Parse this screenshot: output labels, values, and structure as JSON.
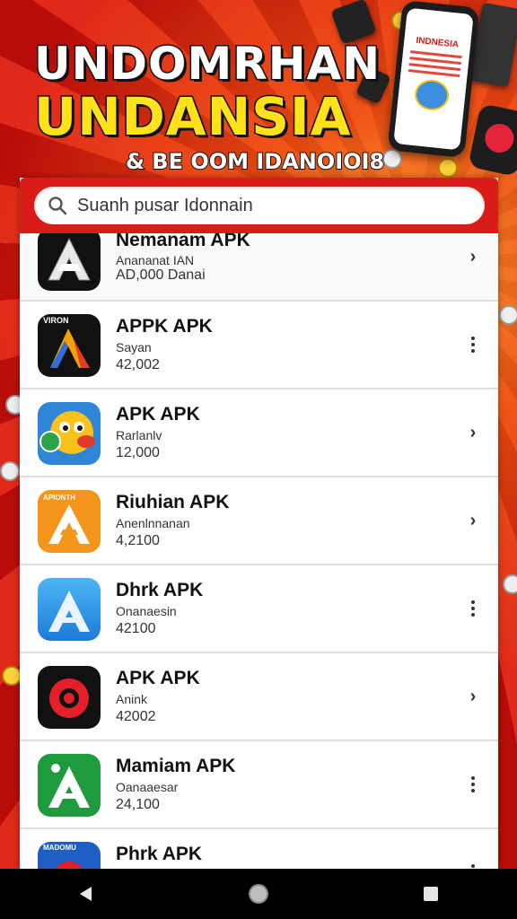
{
  "banner": {
    "title_line1": "UNDOMRHAN",
    "title_line2": "UNDANSIA",
    "subtitle": "& BE OOM IDANOIOI8",
    "phone_screen_title": "INDNESIA"
  },
  "search": {
    "placeholder": "Suanh pusar Idonnain"
  },
  "apps": [
    {
      "name": "Nemanam APK",
      "subtitle": "Anananat IAN",
      "size": "AD,000 Danai",
      "action": "chevron"
    },
    {
      "name": "APPK APK",
      "subtitle": "Sayan",
      "size": "42,002",
      "action": "more",
      "icon_label": "VIRON"
    },
    {
      "name": "APK APK",
      "subtitle": "Rarlanlv",
      "size": "12,000",
      "action": "chevron"
    },
    {
      "name": "Riuhian APK",
      "subtitle": "Anenlnnanan",
      "size": "4,2100",
      "action": "chevron",
      "icon_label": "APIONTH"
    },
    {
      "name": "Dhrk APK",
      "subtitle": "Onanaesin",
      "size": "42100",
      "action": "more"
    },
    {
      "name": "APK APK",
      "subtitle": "Anink",
      "size": "42002",
      "action": "chevron"
    },
    {
      "name": "Mamiam APK",
      "subtitle": "Oanaaesar",
      "size": "24,100",
      "action": "more"
    },
    {
      "name": "Phrk APK",
      "subtitle": "",
      "size": "",
      "action": "more",
      "icon_label": "MADOMU"
    }
  ],
  "colors": {
    "accent_red": "#d91c17",
    "title_yellow": "#ffe21a"
  },
  "navigation": {
    "back_icon": "triangle-back-icon",
    "home_icon": "circle-home-icon",
    "recents_icon": "square-recents-icon"
  }
}
